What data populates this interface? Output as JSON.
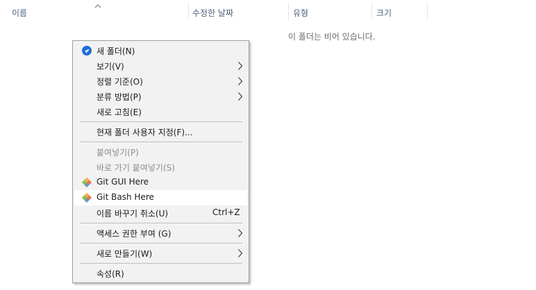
{
  "columns": [
    {
      "label": "이름"
    },
    {
      "label": "수정한 날짜"
    },
    {
      "label": "유형"
    },
    {
      "label": "크기"
    }
  ],
  "empty_message": "이 폴더는 비어 있습니다.",
  "context_menu": {
    "items": [
      {
        "label": "새 폴더(N)",
        "icon": "new-folder-icon"
      },
      {
        "label": "보기(V)",
        "submenu": true
      },
      {
        "label": "정렬 기준(O)",
        "submenu": true
      },
      {
        "label": "분류 방법(P)",
        "submenu": true
      },
      {
        "label": "새로 고침(E)"
      },
      {
        "label": "현재 폴더 사용자 지정(F)..."
      },
      {
        "label": "붙여넣기(P)",
        "disabled": true
      },
      {
        "label": "바로 가기 붙여넣기(S)",
        "disabled": true
      },
      {
        "label": "Git GUI Here",
        "icon": "git-icon"
      },
      {
        "label": "Git Bash Here",
        "icon": "git-icon",
        "highlighted": true
      },
      {
        "label": "이름 바꾸기 취소(U)",
        "shortcut": "Ctrl+Z"
      },
      {
        "label": "액세스 권한 부여 (G)",
        "submenu": true
      },
      {
        "label": "새로 만들기(W)",
        "submenu": true
      },
      {
        "label": "속성(R)"
      }
    ]
  },
  "colors": {
    "header_text": "#4c607a",
    "menu_bg": "#f2f2f2",
    "disabled_text": "#8d8d8d",
    "new_folder_icon": "#1e6fd9"
  }
}
